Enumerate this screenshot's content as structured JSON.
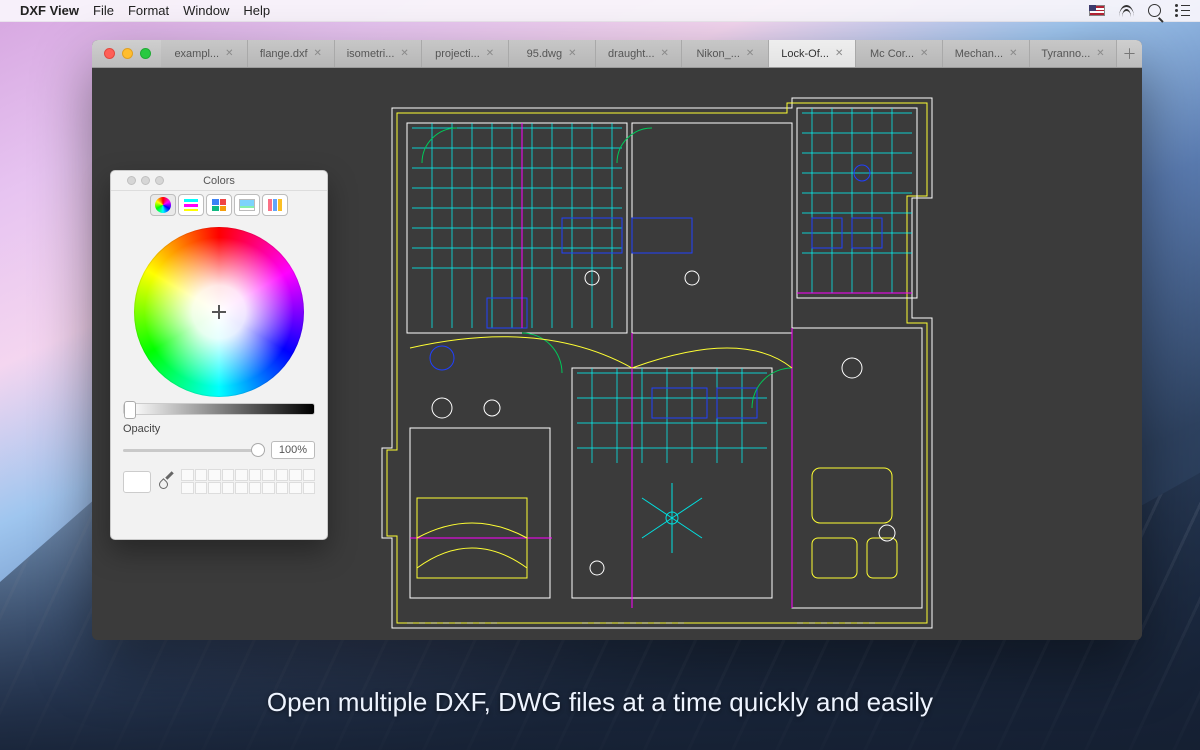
{
  "menubar": {
    "app_name": "DXF View",
    "items": [
      "File",
      "Format",
      "Window",
      "Help"
    ]
  },
  "tabs": {
    "items": [
      {
        "label": "exampl..."
      },
      {
        "label": "flange.dxf"
      },
      {
        "label": "isometri..."
      },
      {
        "label": "projecti..."
      },
      {
        "label": "95.dwg"
      },
      {
        "label": "draught..."
      },
      {
        "label": "Nikon_..."
      },
      {
        "label": "Lock-Of...",
        "active": true
      },
      {
        "label": "Mc Cor..."
      },
      {
        "label": "Mechan..."
      },
      {
        "label": "Tyranno..."
      }
    ]
  },
  "colors_panel": {
    "title": "Colors",
    "opacity_label": "Opacity",
    "opacity_value": "100%"
  },
  "caption": "Open multiple DXF, DWG files at a time quickly and easily"
}
